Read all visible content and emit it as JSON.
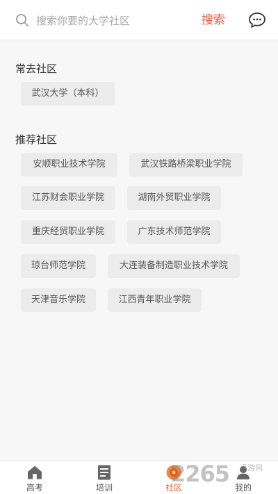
{
  "search": {
    "placeholder": "搜索你要的大学社区",
    "button_label": "搜索"
  },
  "frequent": {
    "title": "常去社区",
    "items": [
      "武汉大学（本科）"
    ]
  },
  "recommended": {
    "title": "推荐社区",
    "items": [
      "安顺职业技术学院",
      "武汉铁路桥梁职业学院",
      "江苏财会职业学院",
      "湖南外贸职业学院",
      "重庆经贸职业学院",
      "广东技术师范学院",
      "琼台师范学院",
      "大连装备制造职业技术学院",
      "天津音乐学院",
      "江西青年职业学院"
    ]
  },
  "tabbar": {
    "tabs": [
      {
        "label": "高考",
        "icon": "home-icon",
        "active": false
      },
      {
        "label": "培训",
        "icon": "list-icon",
        "active": false
      },
      {
        "label": "社区",
        "icon": "community-icon",
        "active": true
      },
      {
        "label": "我的",
        "icon": "user-icon",
        "active": false
      }
    ]
  },
  "watermark": {
    "text": "2265",
    "suffix": "手游网"
  },
  "colors": {
    "accent": "#e4573b",
    "tag_bg": "#ececec",
    "page_bg": "#f7f7f7"
  }
}
